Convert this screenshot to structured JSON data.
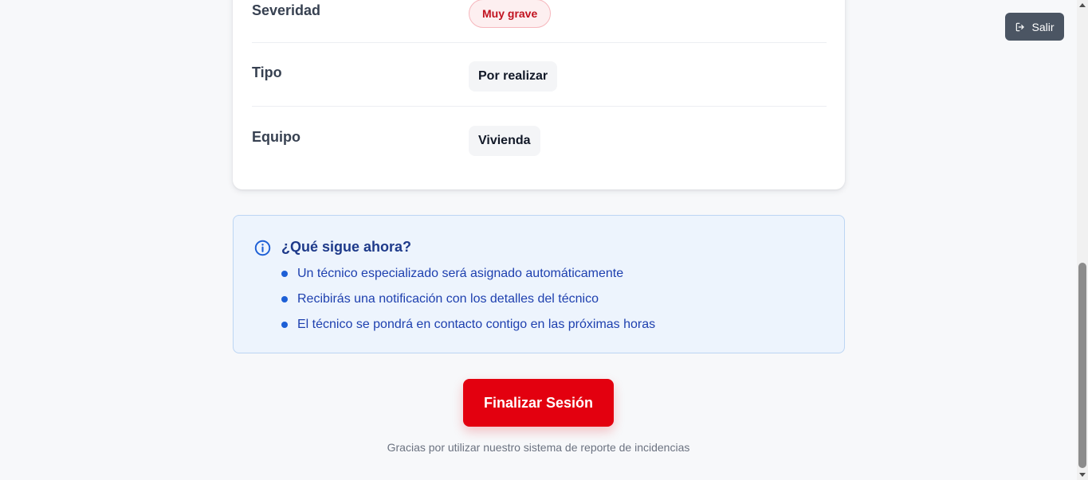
{
  "details": {
    "rows": [
      {
        "label": "Severidad",
        "value": "Muy grave"
      },
      {
        "label": "Tipo",
        "value": "Por realizar"
      },
      {
        "label": "Equipo",
        "value": "Vivienda"
      }
    ],
    "severity_color": "#c1121f"
  },
  "info": {
    "icon": "info-circle-icon",
    "title": "¿Qué sigue ahora?",
    "items": [
      "Un técnico especializado será asignado automáticamente",
      "Recibirás una notificación con los detalles del técnico",
      "El técnico se pondrá en contacto contigo en las próximas horas"
    ],
    "accent_color": "#1d5fd6"
  },
  "actions": {
    "finish_label": "Finalizar Sesión",
    "finish_color": "#e3000f",
    "logout_label": "Salir",
    "logout_icon": "logout-icon"
  },
  "footer": {
    "text": "Gracias por utilizar nuestro sistema de reporte de incidencias"
  }
}
